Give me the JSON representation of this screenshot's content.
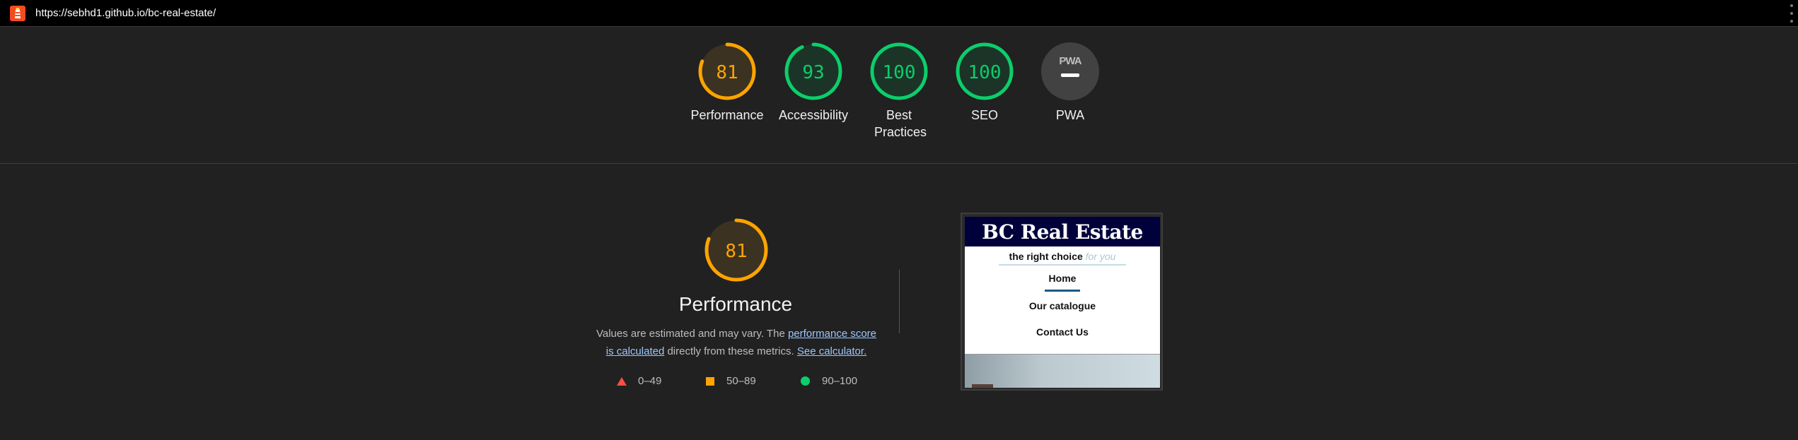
{
  "topbar": {
    "url": "https://sebhd1.github.io/bc-real-estate/"
  },
  "colors": {
    "average": "#ffa400",
    "pass": "#0cce6b",
    "fail": "#ff4e42",
    "na": "#8f8f8f"
  },
  "gauges": [
    {
      "id": "performance",
      "score": "81",
      "label": "Performance",
      "status": "average"
    },
    {
      "id": "accessibility",
      "score": "93",
      "label": "Accessibility",
      "status": "pass"
    },
    {
      "id": "best-practices",
      "score": "100",
      "label": "Best Practices",
      "status": "pass"
    },
    {
      "id": "seo",
      "score": "100",
      "label": "SEO",
      "status": "pass"
    },
    {
      "id": "pwa",
      "score": "",
      "label": "PWA",
      "status": "na",
      "icon": "PWA"
    }
  ],
  "performance": {
    "score": "81",
    "title": "Performance",
    "desc_before": "Values are estimated and may vary. The ",
    "desc_link1": "performance score is calculated",
    "desc_mid": " directly from these metrics. ",
    "desc_link2": "See calculator."
  },
  "legend": [
    {
      "shape": "triangle",
      "range": "0–49"
    },
    {
      "shape": "square",
      "range": "50–89"
    },
    {
      "shape": "circle",
      "range": "90–100"
    }
  ],
  "screenshot": {
    "site_title": "BC Real Estate",
    "tagline_main": "the right choice",
    "tagline_em": "for you",
    "nav": [
      "Home",
      "Our catalogue",
      "Contact Us"
    ]
  }
}
